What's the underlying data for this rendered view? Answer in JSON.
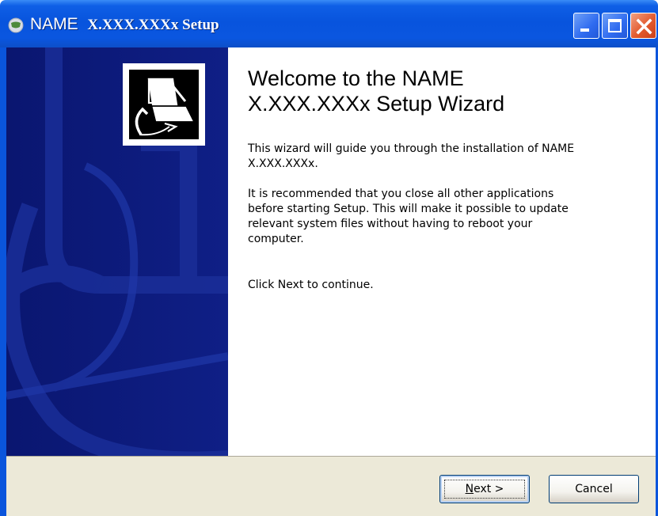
{
  "window": {
    "title_name": "NAME",
    "title_version": "X.XXX.XXXx Setup"
  },
  "heading": {
    "line1": "Welcome to the NAME",
    "line2": "X.XXX.XXXx  Setup Wizard"
  },
  "body": {
    "p1_line1": "This wizard will guide you through the installation of NAME",
    "p1_line2": "X.XXX.XXXx.",
    "p2_line1": "It is recommended that you close all other applications",
    "p2_line2": "before starting Setup. This will make it possible to update",
    "p2_line3": "relevant system files without having to reboot your",
    "p2_line4": "computer.",
    "p3": "Click Next to continue."
  },
  "buttons": {
    "next_mnemonic": "N",
    "next_rest": "ext >",
    "cancel": "Cancel"
  },
  "icons": {
    "app": "installer-globe-icon",
    "hero": "computer-install-icon",
    "minimize": "minimize-icon",
    "maximize": "maximize-icon",
    "close": "close-icon"
  },
  "colors": {
    "titlebar": "#0854dd",
    "sidebar": "#0c1a78",
    "footer": "#ece9d8",
    "close_button": "#e35a2e"
  }
}
